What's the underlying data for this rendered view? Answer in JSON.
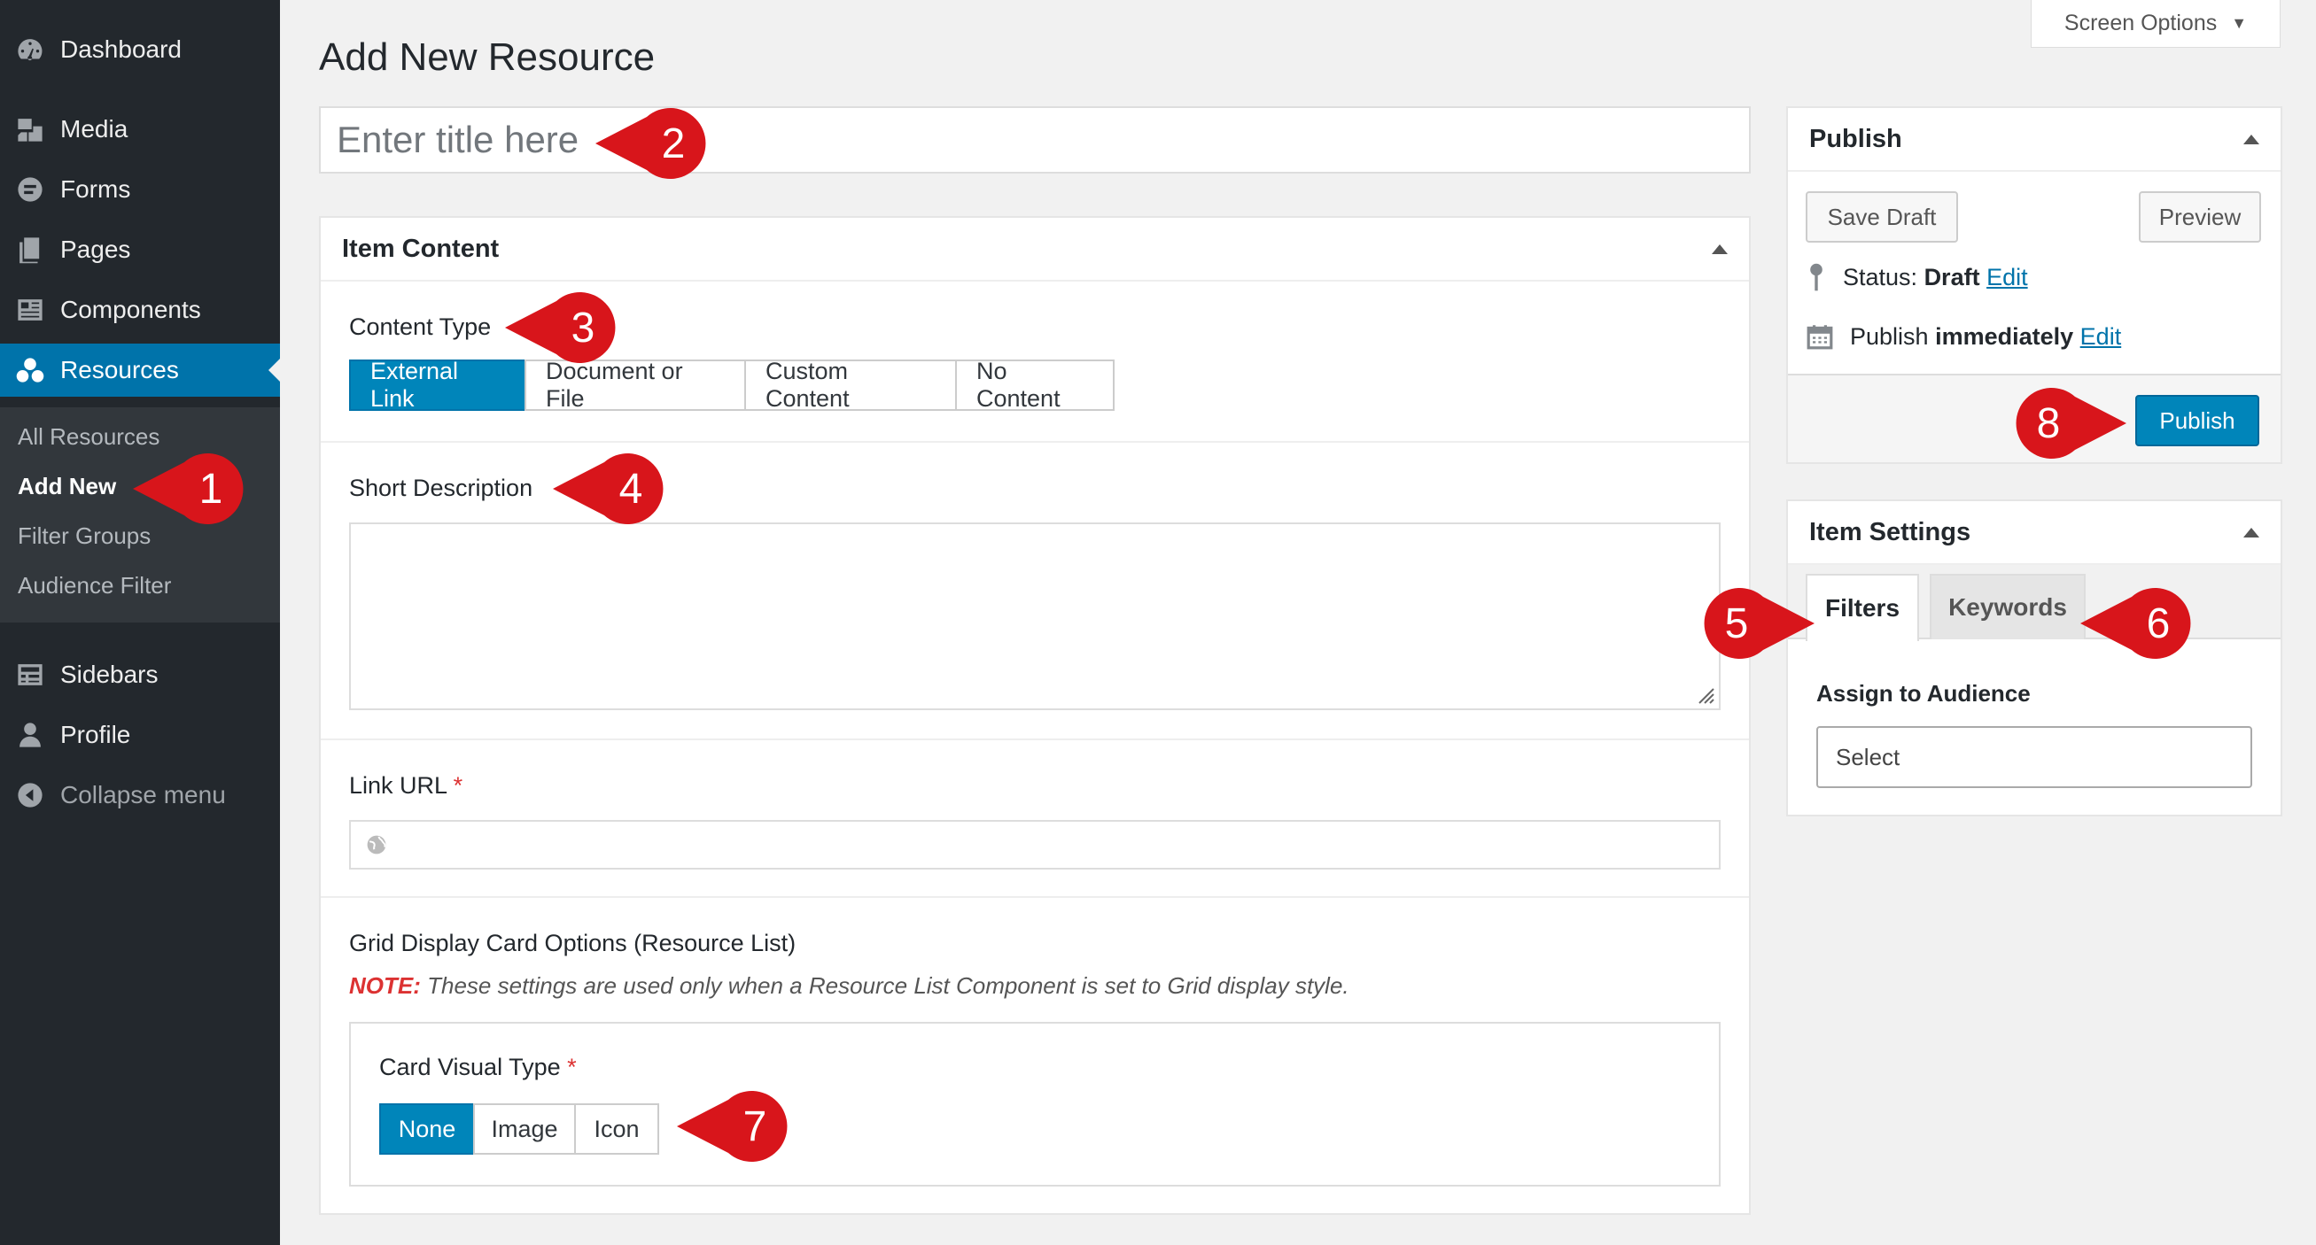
{
  "sidebar": {
    "items": [
      {
        "label": "Dashboard",
        "icon": "dashboard-icon"
      },
      {
        "label": "Media",
        "icon": "media-icon"
      },
      {
        "label": "Forms",
        "icon": "forms-icon"
      },
      {
        "label": "Pages",
        "icon": "pages-icon"
      },
      {
        "label": "Components",
        "icon": "components-icon"
      },
      {
        "label": "Resources",
        "icon": "resources-icon",
        "active": true
      },
      {
        "label": "Sidebars",
        "icon": "sidebars-icon"
      },
      {
        "label": "Profile",
        "icon": "profile-icon"
      },
      {
        "label": "Collapse menu",
        "icon": "collapse-icon"
      }
    ],
    "submenu": [
      "All Resources",
      "Add New",
      "Filter Groups",
      "Audience Filter"
    ]
  },
  "header": {
    "screen_options": "Screen Options",
    "page_title": "Add New Resource"
  },
  "title_input": {
    "placeholder": "Enter title here"
  },
  "item_content": {
    "heading": "Item Content",
    "content_type_label": "Content Type",
    "content_types": [
      "External Link",
      "Document or File",
      "Custom Content",
      "No Content"
    ],
    "content_type_selected": "External Link",
    "short_description_label": "Short Description",
    "link_url_label": "Link URL",
    "required_mark": "*",
    "grid_options_label": "Grid Display Card Options (Resource List)",
    "note_label": "NOTE:",
    "note_text": "These settings are used only when a Resource List Component is set to Grid display style.",
    "card_visual_type_label": "Card Visual Type",
    "card_visual_types": [
      "None",
      "Image",
      "Icon"
    ],
    "card_visual_selected": "None"
  },
  "publish": {
    "heading": "Publish",
    "save_draft": "Save Draft",
    "preview": "Preview",
    "status_label": "Status:",
    "status_value": "Draft",
    "edit": "Edit",
    "publish_label": "Publish",
    "publish_value": "immediately",
    "publish_button": "Publish"
  },
  "item_settings": {
    "heading": "Item Settings",
    "tabs": [
      "Filters",
      "Keywords"
    ],
    "active_tab": "Filters",
    "audience_label": "Assign to Audience",
    "audience_select": "Select"
  },
  "callouts": [
    "1",
    "2",
    "3",
    "4",
    "5",
    "6",
    "7",
    "8"
  ],
  "colors": {
    "sidebar_bg": "#23282d",
    "submenu_bg": "#32373c",
    "accent": "#0073aa",
    "button_primary": "#0085ba",
    "callout_red": "#d8151b",
    "required_red": "#dc3232"
  }
}
